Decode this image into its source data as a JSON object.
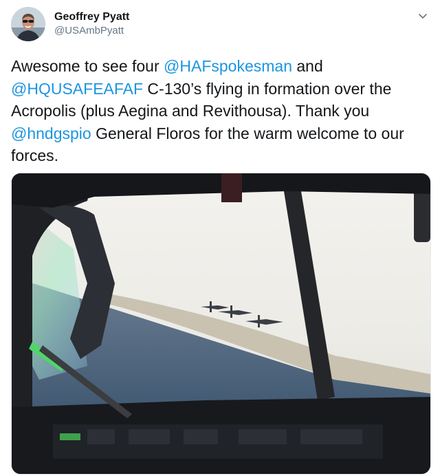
{
  "author": {
    "display_name": "Geoffrey Pyatt",
    "handle": "@USAmbPyatt"
  },
  "tweet": {
    "text_1": "Awesome to see four ",
    "mention_1": "@HAFspokesman",
    "text_2": " and ",
    "mention_2": "@HQUSAFEAFAF",
    "text_3": " C-130’s flying in formation over the Acropolis (plus Aegina and Revithousa).  Thank you ",
    "mention_3": "@hndgspio",
    "text_4": " General Floros for the warm welcome to our forces."
  },
  "icons": {
    "caret": "chevron-down-icon"
  },
  "colors": {
    "mention": "#1b95e0",
    "handle": "#657786",
    "text": "#14171a"
  }
}
